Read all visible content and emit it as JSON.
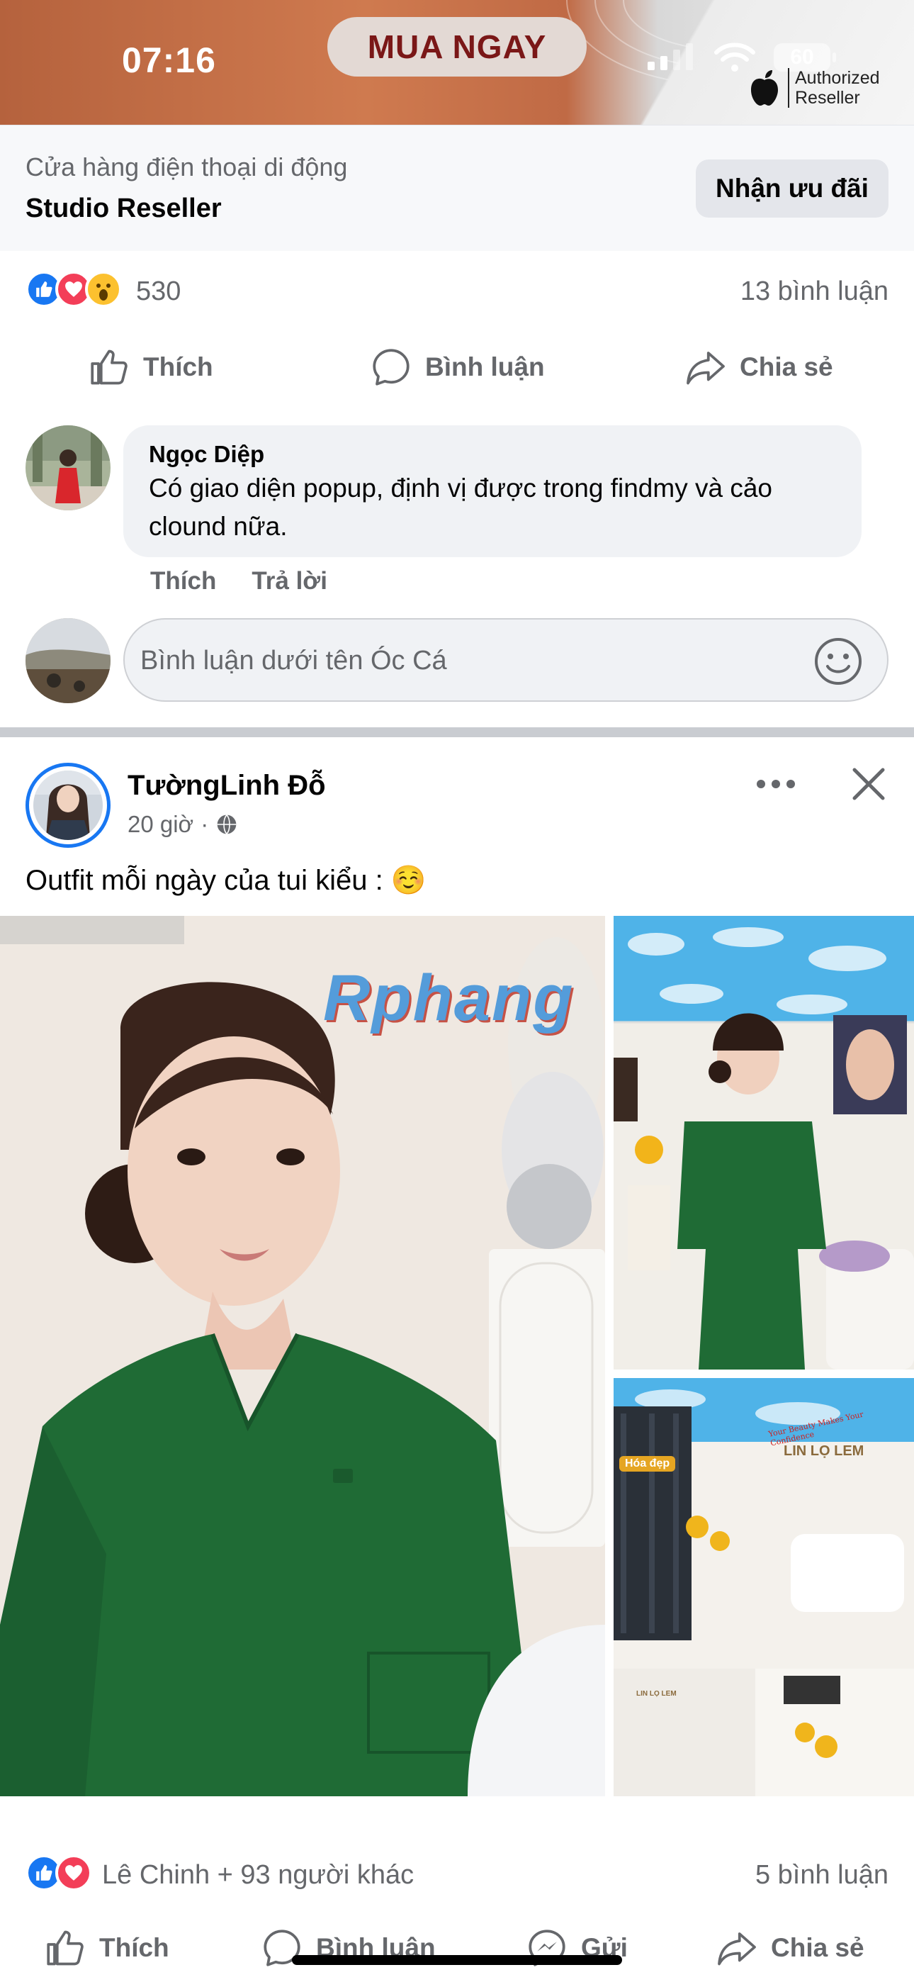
{
  "status_bar": {
    "time": "07:16",
    "battery": "60"
  },
  "ad": {
    "cta_label": "MUA NGAY",
    "reseller_line1": "Authorized",
    "reseller_line2": "Reseller"
  },
  "sponsor": {
    "category": "Cửa hàng điện thoại di động",
    "name": "Studio Reseller",
    "offer_label": "Nhận ưu đãi"
  },
  "post1": {
    "reaction_count": "530",
    "comment_count": "13 bình luận",
    "actions": {
      "like": "Thích",
      "comment": "Bình luận",
      "share": "Chia sẻ"
    },
    "comment": {
      "author": "Ngọc Diệp",
      "text": "Có giao diện popup, định vị được trong findmy và cảo clound nữa.",
      "like": "Thích",
      "reply": "Trả lời"
    },
    "comment_input_placeholder": "Bình luận dưới tên Óc Cá"
  },
  "post2": {
    "author": "TườngLinh Đỗ",
    "time": "20 giờ",
    "caption": "Outfit mỗi ngày của tui kiểu : ☺️",
    "watermark": "Rphang",
    "photo_signs": {
      "shop": "LIN LỌ LEM",
      "slogan": "Your Beauty Makes Your Confidence",
      "badge": "Hóa đẹp"
    },
    "reaction_text": "Lê Chinh + 93 người khác",
    "comment_count": "5 bình luận",
    "actions": {
      "like": "Thích",
      "comment": "Bình luận",
      "send": "Gửi",
      "share": "Chia sẻ"
    }
  },
  "colors": {
    "brand_blue": "#1877f2",
    "love_red": "#f33e58",
    "text_secondary": "#65676b",
    "ad_cta_text": "#7a1717"
  }
}
